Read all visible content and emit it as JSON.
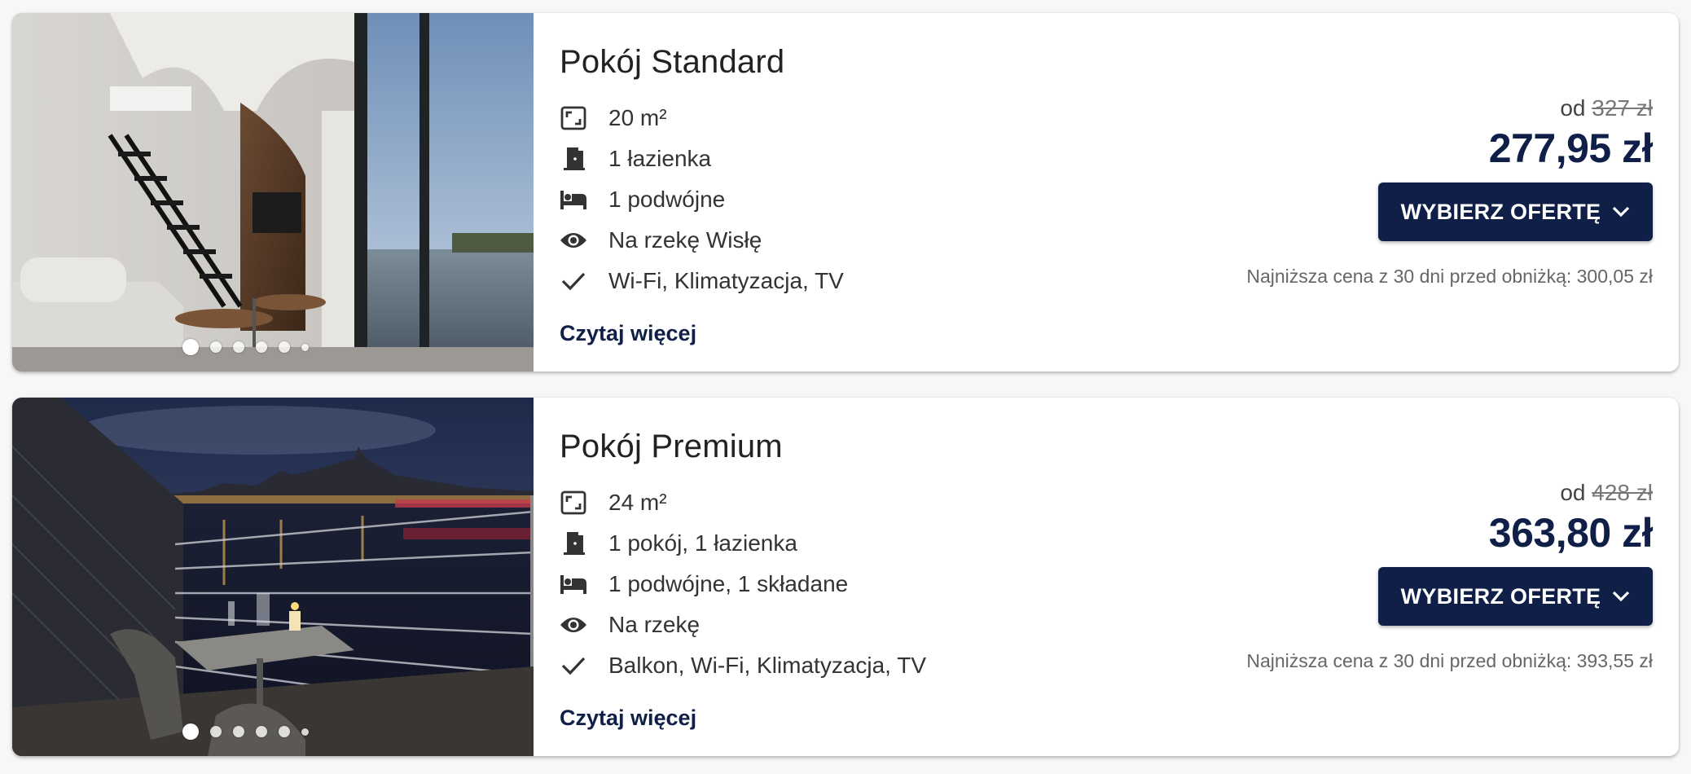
{
  "rooms": [
    {
      "name": "Pokój Standard",
      "features": [
        {
          "icon": "area-icon",
          "text": "20 m²"
        },
        {
          "icon": "door-icon",
          "text": "1 łazienka"
        },
        {
          "icon": "bed-icon",
          "text": "1 podwójne"
        },
        {
          "icon": "eye-icon",
          "text": "Na rzekę Wisłę"
        },
        {
          "icon": "check-icon",
          "text": "Wi-Fi, Klimatyzacja, TV"
        }
      ],
      "read_more": "Czytaj więcej",
      "price_prefix": "od",
      "old_price": "327 zł",
      "price": "277,95 zł",
      "button_label": "WYBIERZ OFERTĘ",
      "lowest_price_note": "Najniższa cena z 30 dni przed obniżką: 300,05 zł",
      "photo_count": 6,
      "active_photo": 1
    },
    {
      "name": "Pokój Premium",
      "features": [
        {
          "icon": "area-icon",
          "text": "24 m²"
        },
        {
          "icon": "door-icon",
          "text": "1 pokój, 1 łazienka"
        },
        {
          "icon": "bed-icon",
          "text": "1 podwójne, 1 składane"
        },
        {
          "icon": "eye-icon",
          "text": "Na rzekę"
        },
        {
          "icon": "check-icon",
          "text": "Balkon, Wi-Fi, Klimatyzacja, TV"
        }
      ],
      "read_more": "Czytaj więcej",
      "price_prefix": "od",
      "old_price": "428 zł",
      "price": "363,80 zł",
      "button_label": "WYBIERZ OFERTĘ",
      "lowest_price_note": "Najniższa cena z 30 dni przed obniżką: 393,55 zł",
      "photo_count": 6,
      "active_photo": 1
    }
  ],
  "colors": {
    "brand": "#0f1f47",
    "text": "#222222",
    "muted": "#666666"
  }
}
